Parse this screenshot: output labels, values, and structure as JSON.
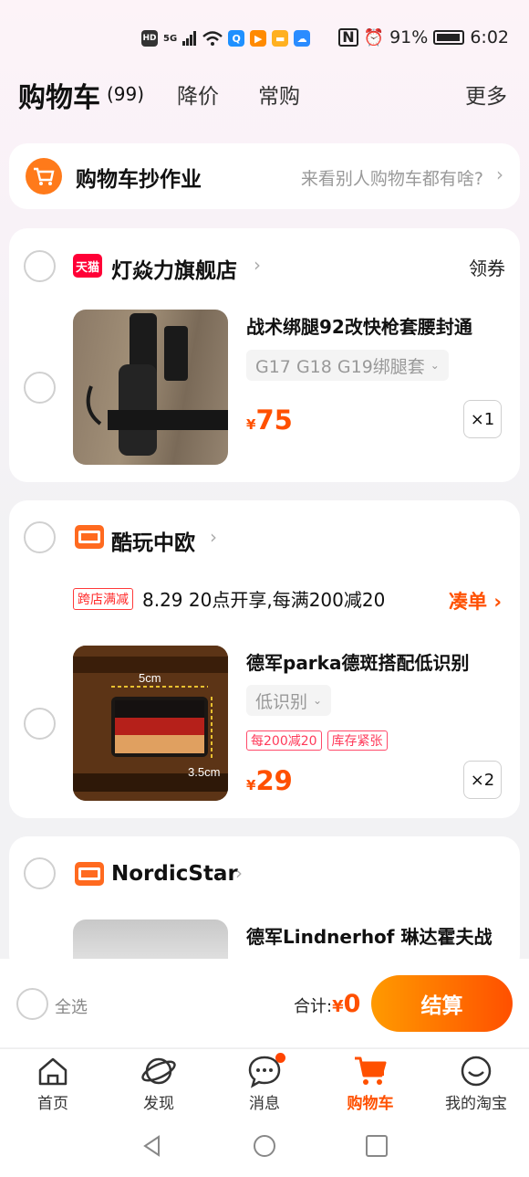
{
  "status_bar": {
    "battery": "91%",
    "time": "6:02",
    "net": "5G"
  },
  "header": {
    "title": "购物车",
    "count": "(99)",
    "tabs": [
      "降价",
      "常购"
    ],
    "more": "更多"
  },
  "homework": {
    "title": "购物车抄作业",
    "subtitle": "来看别人购物车都有啥?"
  },
  "stores": [
    {
      "badge": "天猫",
      "name": "灯焱力旗舰店",
      "coupon": "领券",
      "product": {
        "title": "战术绑腿92改快枪套腰封通",
        "sku": "G17 G18 G19绑腿套",
        "price": "75",
        "qty": "×1"
      }
    },
    {
      "name": "酷玩中欧",
      "promo_tag": "跨店满减",
      "promo_text": "8.29 20点开享,每满200减20",
      "promo_action": "凑单",
      "product": {
        "title": "德军parka德斑搭配低识别",
        "sku": "低识别",
        "tags": [
          "每200减20",
          "库存紧张"
        ],
        "price": "29",
        "qty": "×2",
        "img_labels": [
          "5cm",
          "3.5cm"
        ]
      }
    },
    {
      "name": "NordicStar",
      "product": {
        "title": "德军Lindnerhof 琳达霍夫战"
      }
    }
  ],
  "checkout": {
    "select_all": "全选",
    "total_label": "合计:",
    "currency": "¥",
    "total": "0",
    "pay": "结算"
  },
  "currency": "¥",
  "tabbar": [
    "首页",
    "发现",
    "消息",
    "购物车",
    "我的淘宝"
  ],
  "colors": {
    "accent": "#ff5000",
    "tmall": "#ff0036",
    "store_orange": "#ff6a1f"
  }
}
